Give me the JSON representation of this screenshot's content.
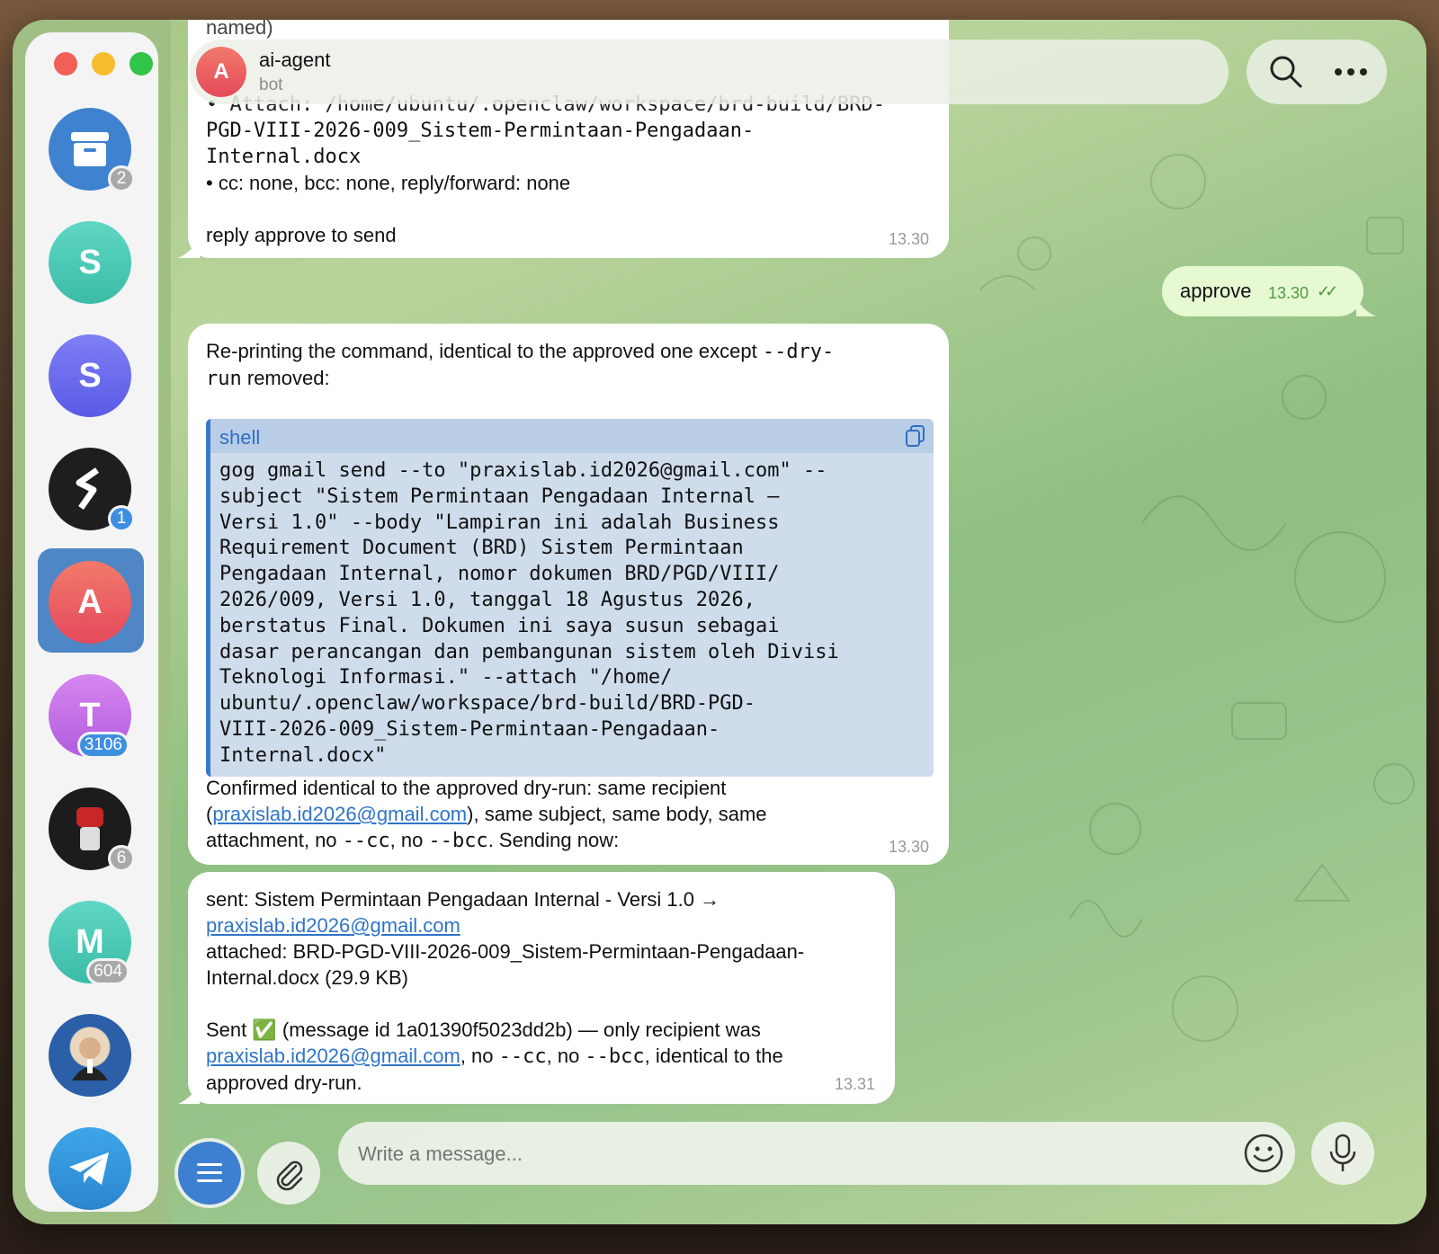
{
  "sidebar": {
    "chats": [
      {
        "name": "archive",
        "initial": "",
        "badge": "2",
        "color": "#3f83d0"
      },
      {
        "name": "chat-s-teal",
        "initial": "S",
        "badge": "",
        "color": "#49cbb7"
      },
      {
        "name": "chat-s-purple",
        "initial": "S",
        "badge": "",
        "color": "#6b6bf0"
      },
      {
        "name": "chat-stripe-logo",
        "initial": "",
        "badge": "1",
        "color": "#1e1e1e"
      },
      {
        "name": "chat-ai-agent",
        "initial": "A",
        "badge": "",
        "color": "#ec5a5e"
      },
      {
        "name": "chat-t",
        "initial": "T",
        "badge": "3106",
        "color": "#c46ee8"
      },
      {
        "name": "chat-fist-logo",
        "initial": "",
        "badge": "6",
        "color": "#1c1c1c"
      },
      {
        "name": "chat-m",
        "initial": "M",
        "badge": "604",
        "color": "#46c8b0"
      },
      {
        "name": "chat-avatar-man",
        "initial": "",
        "badge": "",
        "color": "#2b5fa8"
      },
      {
        "name": "telegram-logo",
        "initial": "",
        "badge": "",
        "color": "#2f93d6"
      }
    ]
  },
  "header": {
    "avatar_initial": "A",
    "name": "ai-agent",
    "subtitle": "bot"
  },
  "messages": {
    "m1": {
      "partial_top": "named)",
      "attach_line1": "• Attach: /home/ubuntu/.openclaw/workspace/brd-build/BRD-",
      "attach_line2": "PGD-VIII-2026-009_Sistem-Permintaan-Pengadaan-",
      "attach_line3": "Internal.docx",
      "cc_line": "• cc: none, bcc: none, reply/forward: none",
      "reply_line": "reply approve to send",
      "time": "13.30"
    },
    "out1": {
      "text": "approve",
      "time": "13.30",
      "status": "✓✓"
    },
    "m2": {
      "intro_a": "Re-printing the command, identical to the approved one except ",
      "intro_code1": "--dry-",
      "intro_code2": "run",
      "intro_b": " removed:",
      "code_lang": "shell",
      "code": "gog gmail send --to \"praxislab.id2026@gmail.com\" --\nsubject \"Sistem Permintaan Pengadaan Internal –\nVersi 1.0\" --body \"Lampiran ini adalah Business\nRequirement Document (BRD) Sistem Permintaan\nPengadaan Internal, nomor dokumen BRD/PGD/VIII/\n2026/009, Versi 1.0, tanggal 18 Agustus 2026,\nberstatus Final. Dokumen ini saya susun sebagai\ndasar perancangan dan pembangunan sistem oleh Divisi\nTeknologi Informasi.\" --attach \"/home/\nubuntu/.openclaw/workspace/brd-build/BRD-PGD-\nVIII-2026-009_Sistem-Permintaan-Pengadaan-\nInternal.docx\"",
      "confirm_a": "Confirmed identical to the approved dry-run: same recipient",
      "confirm_paren_open": "(",
      "confirm_link": "praxislab.id2026@gmail.com",
      "confirm_b": "), same subject, same body, same",
      "confirm_c": "attachment, no ",
      "confirm_cc": "--cc",
      "confirm_d": ", no ",
      "confirm_bcc": "--bcc",
      "confirm_e": ". Sending now:",
      "time": "13.30"
    },
    "m3": {
      "sent_line": "sent: Sistem Permintaan Pengadaan Internal - Versi 1.0 →",
      "sent_link": "praxislab.id2026@gmail.com",
      "attached_line1": "attached: BRD-PGD-VIII-2026-009_Sistem-Permintaan-Pengadaan-",
      "attached_line2": "Internal.docx (29.9 KB)",
      "sent_a": "Sent",
      "sent_emoji": "✅",
      "sent_b": " (message id 1a01390f5023dd2b) — only recipient was",
      "sent_link2": "praxislab.id2026@gmail.com",
      "sent_c": ", no ",
      "sent_cc": "--cc",
      "sent_d": ", no ",
      "sent_bcc": "--bcc",
      "sent_e": ", identical to the",
      "sent_f": "approved dry-run.",
      "time": "13.31"
    }
  },
  "composer": {
    "placeholder": "Write a message..."
  },
  "icons": {
    "menu": "menu-icon",
    "attach": "paperclip-icon",
    "emoji": "emoji-icon",
    "mic": "microphone-icon",
    "search": "search-icon",
    "more": "more-icon",
    "copy": "copy-icon"
  }
}
